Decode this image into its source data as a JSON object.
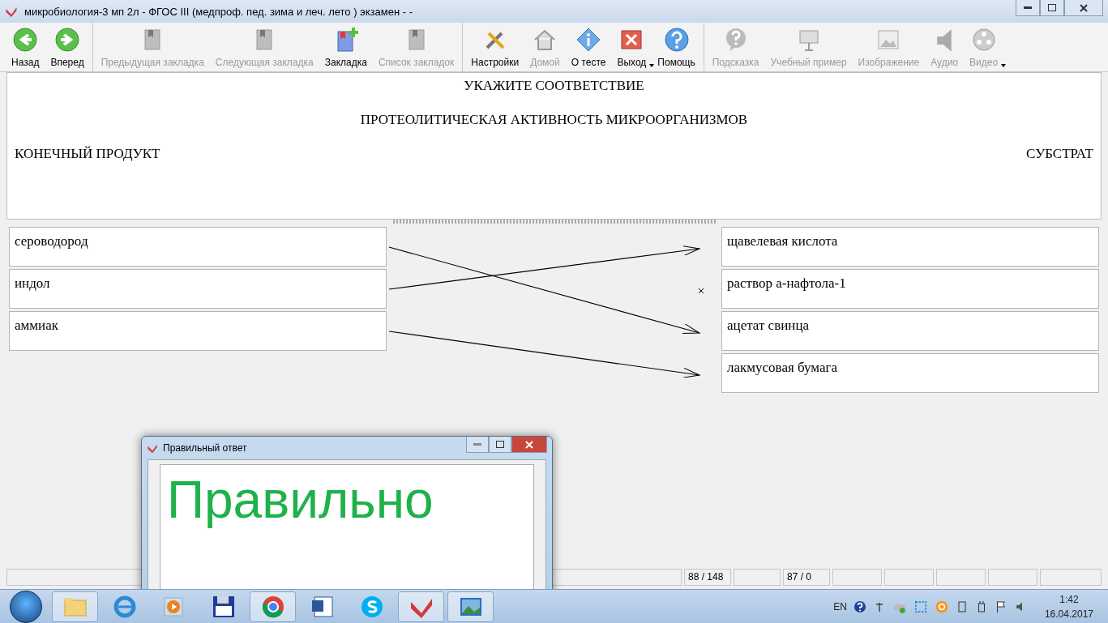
{
  "window": {
    "title": "микробиология-3 мп 2л - ФГОС III (медпроф. пед. зима и леч. лето ) экзамен -  -"
  },
  "toolbar": {
    "groups": [
      [
        {
          "kind": "back",
          "label": "Назад",
          "disabled": false,
          "dropdown": false
        },
        {
          "kind": "forward",
          "label": "Вперед",
          "disabled": false,
          "dropdown": false
        }
      ],
      [
        {
          "kind": "bookmark-prev",
          "label": "Предыдущая закладка",
          "disabled": true,
          "dropdown": false
        },
        {
          "kind": "bookmark-next",
          "label": "Следующая закладка",
          "disabled": true,
          "dropdown": false
        },
        {
          "kind": "bookmark-add",
          "label": "Закладка",
          "disabled": false,
          "dropdown": false
        },
        {
          "kind": "bookmark-list",
          "label": "Список закладок",
          "disabled": true,
          "dropdown": false
        }
      ],
      [
        {
          "kind": "settings",
          "label": "Настройки",
          "disabled": false,
          "dropdown": false
        },
        {
          "kind": "home",
          "label": "Домой",
          "disabled": true,
          "dropdown": false
        },
        {
          "kind": "info",
          "label": "О тесте",
          "disabled": false,
          "dropdown": false
        },
        {
          "kind": "exit",
          "label": "Выход",
          "disabled": false,
          "dropdown": true
        },
        {
          "kind": "help",
          "label": "Помощь",
          "disabled": false,
          "dropdown": false
        }
      ],
      [
        {
          "kind": "hint",
          "label": "Подсказка",
          "disabled": true,
          "dropdown": false
        },
        {
          "kind": "example",
          "label": "Учебный пример",
          "disabled": true,
          "dropdown": false
        },
        {
          "kind": "image",
          "label": "Изображение",
          "disabled": true,
          "dropdown": false
        },
        {
          "kind": "audio",
          "label": "Аудио",
          "disabled": true,
          "dropdown": false
        },
        {
          "kind": "video",
          "label": "Видео",
          "disabled": true,
          "dropdown": true
        }
      ]
    ]
  },
  "question": {
    "instruction": "УКАЖИТЕ СООТВЕТСТВИЕ",
    "topic": "ПРОТЕОЛИТИЧЕСКАЯ АКТИВНОСТЬ МИКРООРГАНИЗМОВ",
    "left_heading": "КОНЕЧНЫЙ ПРОДУКТ",
    "right_heading": "СУБСТРАТ"
  },
  "matching": {
    "left": [
      {
        "text": "сероводород",
        "links": [
          false,
          false,
          true,
          false
        ]
      },
      {
        "text": "индол",
        "links": [
          true,
          false,
          false,
          false
        ]
      },
      {
        "text": "аммиак",
        "links": [
          false,
          false,
          false,
          true
        ]
      }
    ],
    "right": [
      {
        "text": "щавелевая кислота",
        "crossed": false
      },
      {
        "text": "раствор а-нафтола-1",
        "crossed": true
      },
      {
        "text": "ацетат свинца",
        "crossed": false
      },
      {
        "text": "лакмусовая бумага",
        "crossed": false
      }
    ]
  },
  "status_bar": {
    "cells": [
      "88 / 148",
      "",
      "87 / 0"
    ]
  },
  "dialog": {
    "title": "Правильный ответ",
    "message": "Правильно"
  },
  "taskbar": {
    "apps": [
      {
        "kind": "folder",
        "active": true
      },
      {
        "kind": "browser-e",
        "active": false
      },
      {
        "kind": "player",
        "active": false
      },
      {
        "kind": "floppy",
        "active": false
      },
      {
        "kind": "chrome",
        "active": true
      },
      {
        "kind": "word",
        "active": false
      },
      {
        "kind": "skype",
        "active": false
      },
      {
        "kind": "checkmark",
        "active": true
      },
      {
        "kind": "photos",
        "active": true
      }
    ],
    "language": "EN",
    "time": "1:42",
    "date": "16.04.2017"
  }
}
